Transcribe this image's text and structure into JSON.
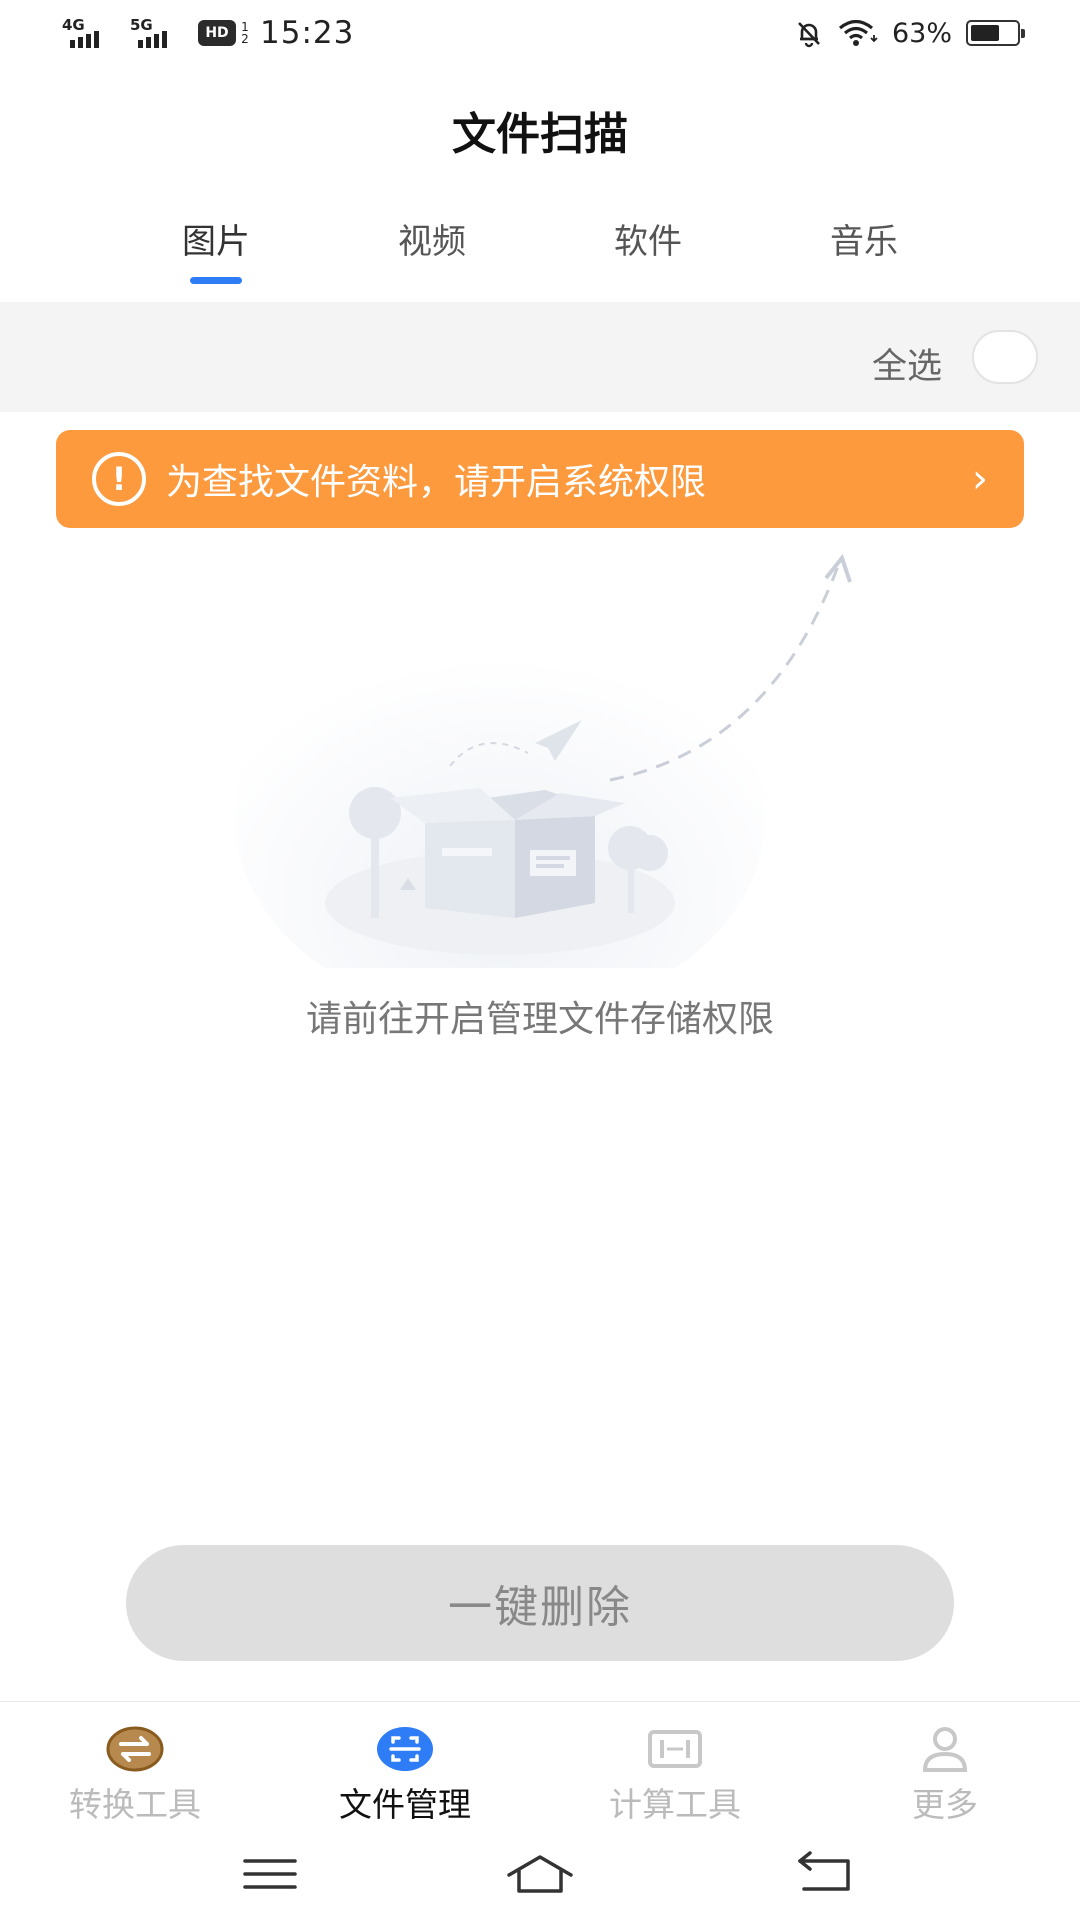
{
  "status_bar": {
    "net1": "4G",
    "net2": "5G",
    "hd": "HD",
    "hd_sup": "1",
    "hd_sub": "2",
    "time": "15:23",
    "battery_percent": "63%",
    "battery_level": 0.63,
    "icons": [
      "mute-bell-icon",
      "wifi-icon",
      "battery-icon"
    ]
  },
  "header": {
    "title": "文件扫描"
  },
  "tabs": [
    {
      "label": "图片",
      "active": true
    },
    {
      "label": "视频",
      "active": false
    },
    {
      "label": "软件",
      "active": false
    },
    {
      "label": "音乐",
      "active": false
    }
  ],
  "select_bar": {
    "label": "全选",
    "checked": false
  },
  "banner": {
    "text": "为查找文件资料，请开启系统权限",
    "icon": "alert-icon",
    "chevron": "›",
    "color": "#fd9a3e"
  },
  "empty_state": {
    "text": "请前往开启管理文件存储权限",
    "illustration": "empty-box-illustration"
  },
  "delete_button": {
    "label": "一键删除"
  },
  "bottom_nav": [
    {
      "label": "转换工具",
      "icon": "convert-icon",
      "active": false
    },
    {
      "label": "文件管理",
      "icon": "scan-icon",
      "active": true
    },
    {
      "label": "计算工具",
      "icon": "calculator-icon",
      "active": false
    },
    {
      "label": "更多",
      "icon": "user-icon",
      "active": false
    }
  ],
  "system_nav": {
    "icons": [
      "menu-icon",
      "home-icon",
      "back-icon"
    ]
  },
  "colors": {
    "accent": "#2e7cf6",
    "banner": "#fd9a3e",
    "button_disabled": "#dedede"
  }
}
